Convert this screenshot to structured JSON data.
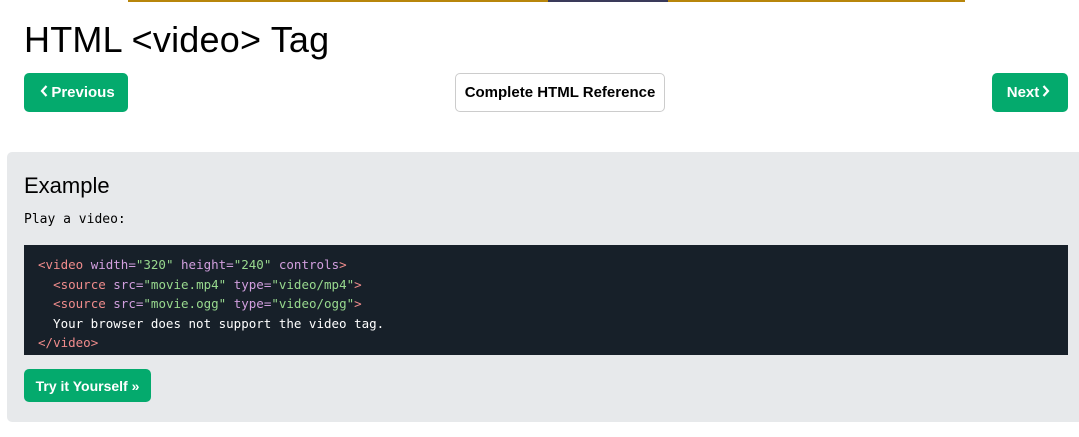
{
  "page": {
    "title": "HTML <video> Tag"
  },
  "nav": {
    "prev_label": "Previous",
    "prev_icon": "chevron-left-icon",
    "reference_label": "Complete HTML Reference",
    "next_label": "Next",
    "next_icon": "chevron-right-icon"
  },
  "example": {
    "heading": "Example",
    "description": "Play a video:",
    "code": {
      "line1": {
        "open": "<",
        "tag": "video",
        "a1": " width=",
        "v1": "\"320\"",
        "a2": " height=",
        "v2": "\"240\"",
        "a3": " controls",
        "close": ">"
      },
      "line2": {
        "indent": "  ",
        "open": "<",
        "tag": "source",
        "a1": " src=",
        "v1": "\"movie.mp4\"",
        "a2": " type=",
        "v2": "\"video/mp4\"",
        "close": ">"
      },
      "line3": {
        "indent": "  ",
        "open": "<",
        "tag": "source",
        "a1": " src=",
        "v1": "\"movie.ogg\"",
        "a2": " type=",
        "v2": "\"video/ogg\"",
        "close": ">"
      },
      "line4": {
        "text": "  Your browser does not support the video tag."
      },
      "line5": {
        "open": "</",
        "tag": "video",
        "close": ">"
      }
    },
    "try_label": "Try it Yourself »"
  },
  "colors": {
    "accent_green": "#04aa6d",
    "example_bg": "#e7e9eb",
    "code_bg": "#172029"
  }
}
